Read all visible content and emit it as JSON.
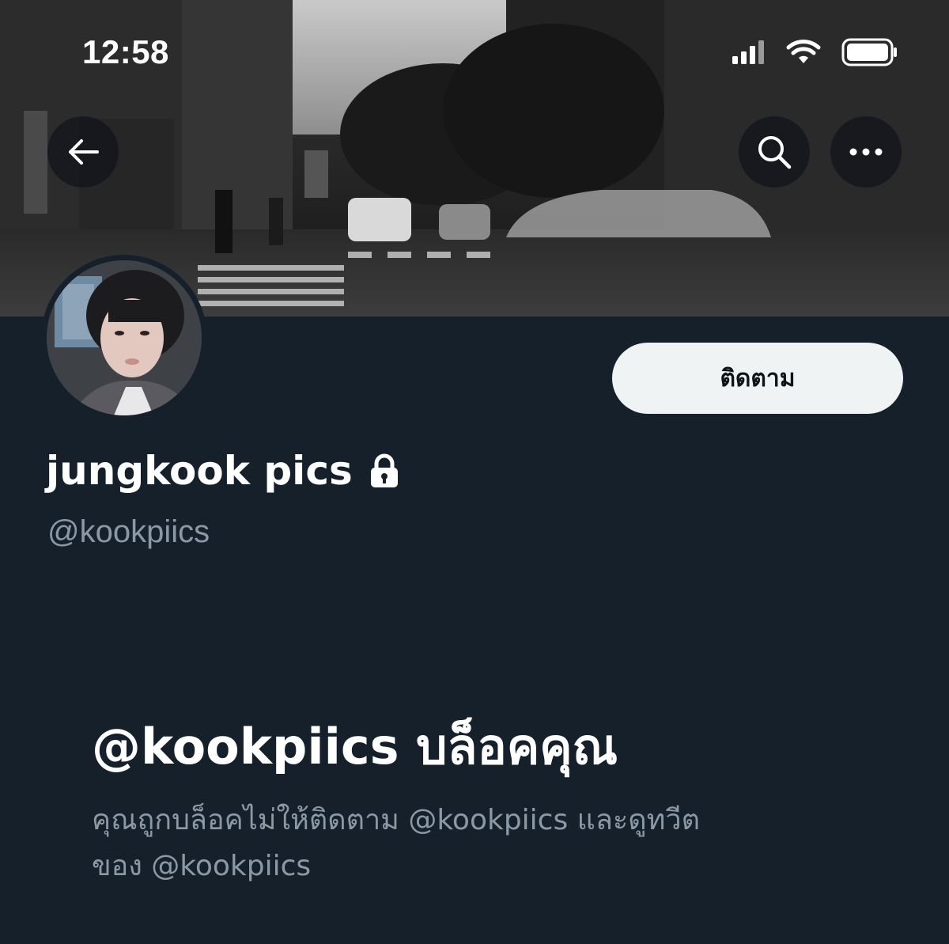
{
  "status_bar": {
    "time": "12:58",
    "icons": [
      "signal-icon",
      "wifi-icon",
      "battery-icon"
    ]
  },
  "header": {
    "back_icon": "arrow-left-icon",
    "search_icon": "search-icon",
    "more_icon": "more-horizontal-icon"
  },
  "profile": {
    "display_name": "jungkook pics",
    "protected_icon": "lock-icon",
    "handle": "@kookpiics",
    "follow_label": "ติดตาม"
  },
  "blocked_notice": {
    "title": "@kookpiics บล็อคคุณ",
    "description_line1": "คุณถูกบล็อคไม่ให้ติดตาม @kookpiics และดูทวีต",
    "description_line2": "ของ @kookpiics"
  },
  "colors": {
    "background": "#15202b",
    "secondary_text": "#8b98a5",
    "button_bg": "#eff3f4",
    "button_text": "#0f1419"
  }
}
